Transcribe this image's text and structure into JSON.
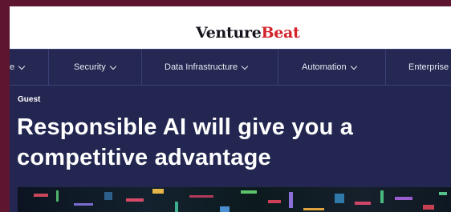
{
  "brand": {
    "part1": "Venture",
    "part2": "Beat"
  },
  "nav": {
    "items": [
      {
        "label": "e",
        "key": "partial-left"
      },
      {
        "label": "Security",
        "key": "security"
      },
      {
        "label": "Data Infrastructure",
        "key": "data-infrastructure"
      },
      {
        "label": "Automation",
        "key": "automation"
      },
      {
        "label": "Enterprise",
        "key": "enterprise"
      }
    ]
  },
  "article": {
    "tag": "Guest",
    "headline": "Responsible AI will give you a competitive advantage"
  },
  "colors": {
    "page_bg": "#5e1530",
    "site_bg": "#222650",
    "brand_accent": "#d3232b"
  }
}
